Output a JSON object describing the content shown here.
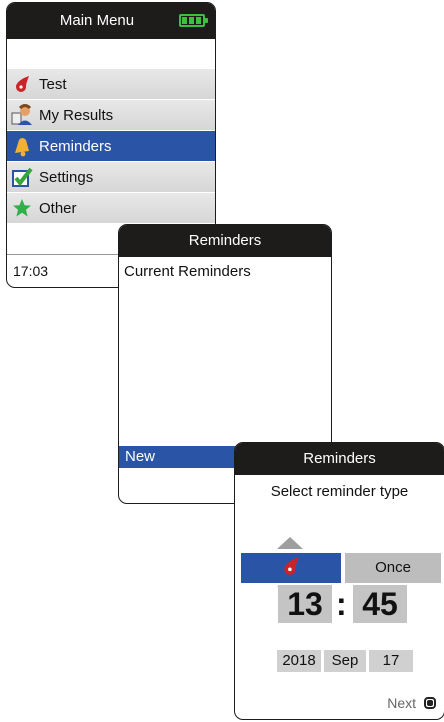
{
  "main_menu": {
    "title": "Main Menu",
    "items": [
      {
        "label": "Test",
        "icon": "blood-drop-icon"
      },
      {
        "label": "My Results",
        "icon": "person-chart-icon"
      },
      {
        "label": "Reminders",
        "icon": "bell-icon",
        "selected": true
      },
      {
        "label": "Settings",
        "icon": "checkmark-box-icon"
      },
      {
        "label": "Other",
        "icon": "star-icon"
      }
    ],
    "time": "17:03"
  },
  "reminders_list": {
    "title": "Reminders",
    "heading": "Current Reminders",
    "new_label": "New"
  },
  "reminder_type": {
    "title": "Reminders",
    "subtitle": "Select reminder type",
    "option_right": "Once",
    "hours": "13",
    "colon": ":",
    "minutes": "45",
    "year": "2018",
    "month": "Sep",
    "day": "17",
    "next_label": "Next"
  },
  "colors": {
    "titlebar": "#1e1b1b",
    "selected": "#2a55a6",
    "battery": "#3fbf3f",
    "drop": "#c8242a"
  }
}
